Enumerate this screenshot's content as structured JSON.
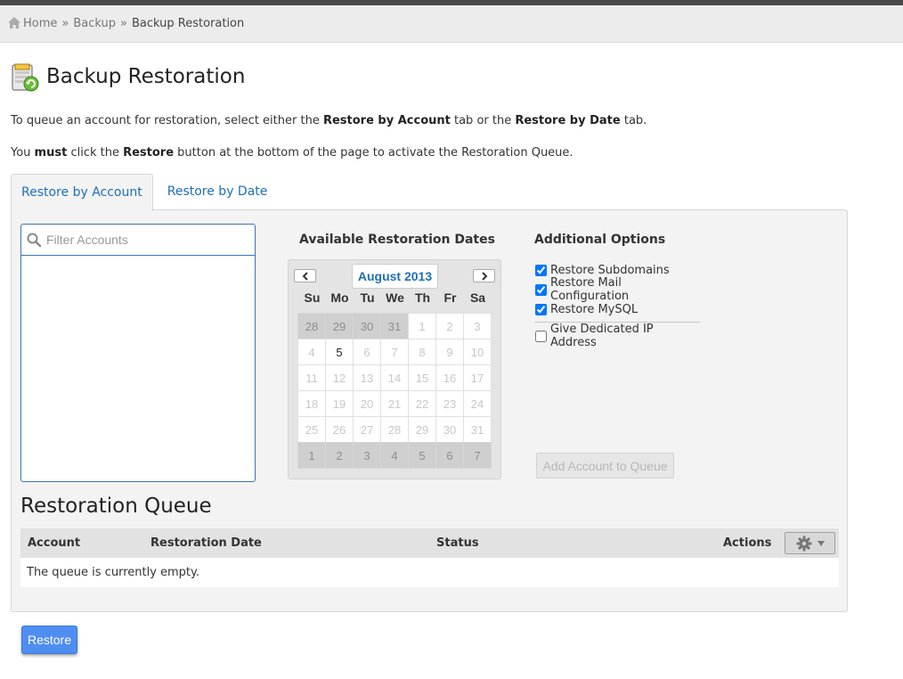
{
  "breadcrumb": {
    "home": "Home",
    "sep": "»",
    "backup": "Backup",
    "current": "Backup Restoration"
  },
  "page": {
    "title": "Backup Restoration",
    "icon": "backup-restore-icon"
  },
  "intro": {
    "line1": {
      "pre": "To queue an account for restoration, select either the ",
      "b1": "Restore by Account",
      "mid": " tab or the ",
      "b2": "Restore by Date",
      "post": " tab."
    },
    "line2": {
      "pre": "You ",
      "b1": "must",
      "mid": " click the ",
      "b2": "Restore",
      "post": " button at the bottom of the page to activate the Restoration Queue."
    }
  },
  "tabs": [
    {
      "label": "Restore by Account",
      "active": true
    },
    {
      "label": "Restore by Date",
      "active": false
    }
  ],
  "filter": {
    "placeholder": "Filter Accounts",
    "value": "",
    "icon": "search-icon"
  },
  "calendar": {
    "heading": "Available Restoration Dates",
    "month": "August 2013",
    "prev_icon": "chevron-left-icon",
    "next_icon": "chevron-right-icon",
    "weekdays": [
      "Su",
      "Mo",
      "Tu",
      "We",
      "Th",
      "Fr",
      "Sa"
    ],
    "weeks": [
      [
        "28",
        "29",
        "30",
        "31",
        "1",
        "2",
        "3"
      ],
      [
        "4",
        "5",
        "6",
        "7",
        "8",
        "9",
        "10"
      ],
      [
        "11",
        "12",
        "13",
        "14",
        "15",
        "16",
        "17"
      ],
      [
        "18",
        "19",
        "20",
        "21",
        "22",
        "23",
        "24"
      ],
      [
        "25",
        "26",
        "27",
        "28",
        "29",
        "30",
        "31"
      ],
      [
        "1",
        "2",
        "3",
        "4",
        "5",
        "6",
        "7"
      ]
    ],
    "available_dates": [
      "5"
    ]
  },
  "options": {
    "heading": "Additional Options",
    "items": [
      {
        "label": "Restore Subdomains",
        "checked": true
      },
      {
        "label": "Restore Mail Configuration",
        "checked": true
      },
      {
        "label": "Restore MySQL",
        "checked": true
      }
    ],
    "extra": {
      "label": "Give Dedicated IP Address",
      "checked": false
    },
    "add_button": "Add Account to Queue"
  },
  "queue": {
    "title": "Restoration Queue",
    "columns": [
      "Account",
      "Restoration Date",
      "Status",
      "Actions"
    ],
    "actions_icon": "gear-icon",
    "dropdown_icon": "caret-down-icon",
    "empty_message": "The queue is currently empty."
  },
  "restore_button": "Restore",
  "colors": {
    "link": "#1f6fb7",
    "primary_button": "#4f8ef0",
    "focus_border": "#3b74b5"
  }
}
